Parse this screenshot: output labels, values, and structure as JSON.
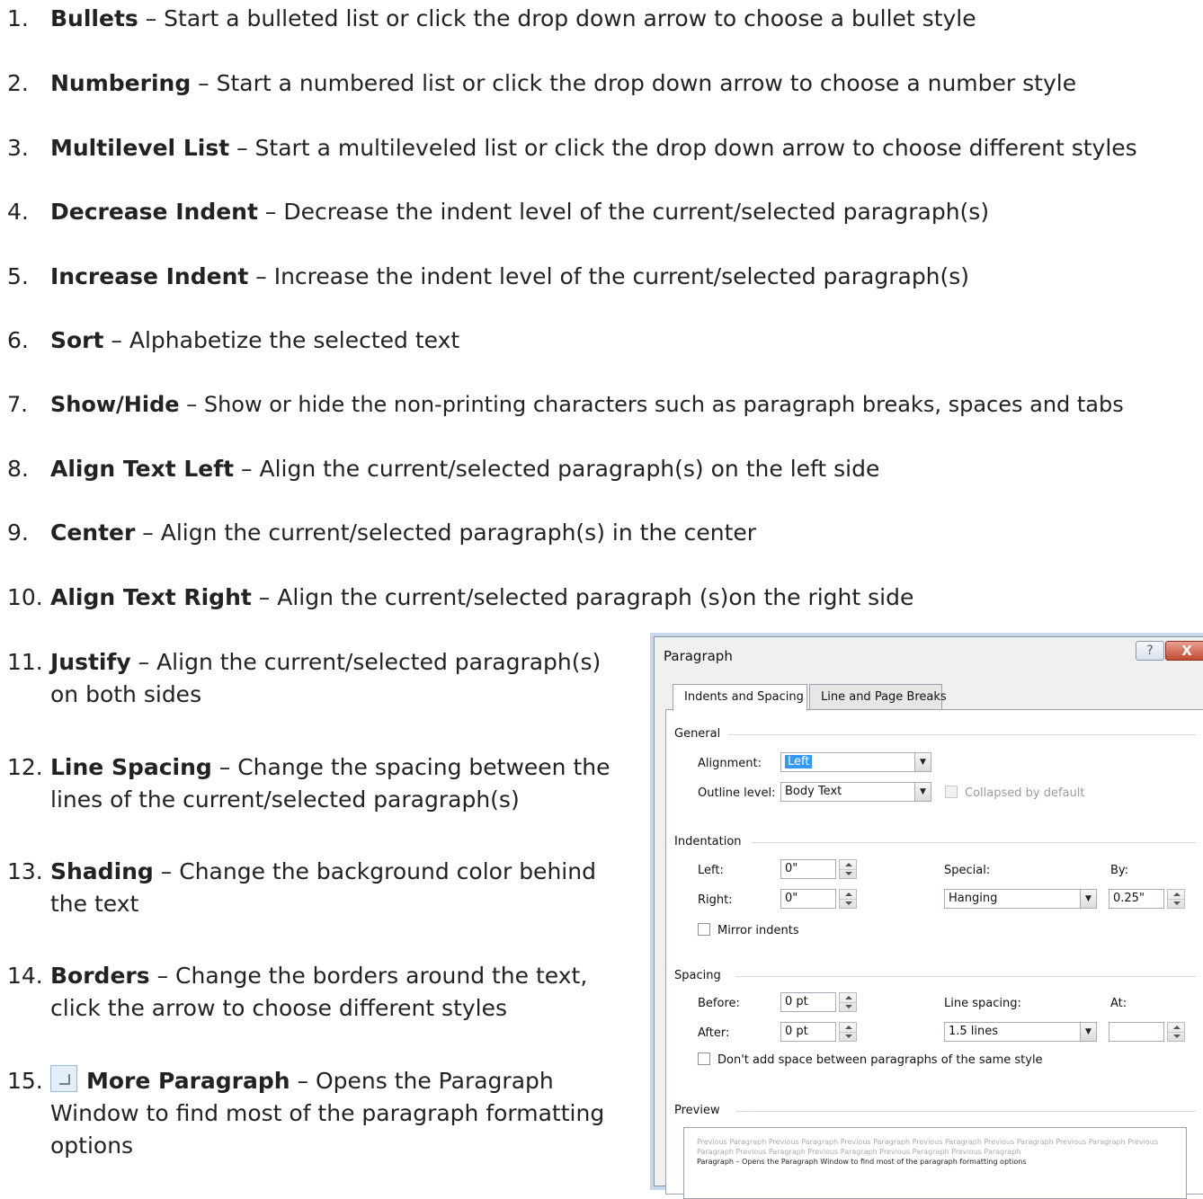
{
  "items": [
    {
      "num": "1.",
      "title": "Bullets",
      "desc": " – Start a bulleted list or click the drop down arrow to choose a bullet style"
    },
    {
      "num": "2.",
      "title": "Numbering",
      "desc": " – Start a numbered list or click the drop down arrow to choose a number style"
    },
    {
      "num": "3.",
      "title": "Multilevel List",
      "desc": " – Start a multileveled list or click the drop down arrow to choose different styles"
    },
    {
      "num": "4.",
      "title": "Decrease Indent",
      "desc": " – Decrease the indent level of the current/selected paragraph(s)"
    },
    {
      "num": "5.",
      "title": "Increase Indent",
      "desc": " – Increase the indent level of the current/selected paragraph(s)"
    },
    {
      "num": "6.",
      "title": "Sort",
      "desc": " – Alphabetize the selected text"
    },
    {
      "num": "7.",
      "title": "Show/Hide",
      "desc": " – Show or hide the non-printing characters such as paragraph breaks, spaces and tabs"
    },
    {
      "num": "8.",
      "title": "Align Text Left",
      "desc": " – Align the current/selected paragraph(s) on the left side"
    },
    {
      "num": "9.",
      "title": "Center",
      "desc": " – Align the current/selected paragraph(s) in the center"
    },
    {
      "num": "10.",
      "title": "Align Text Right",
      "desc": " – Align the current/selected paragraph (s)on the right side"
    },
    {
      "num": "11.",
      "title": "Justify",
      "desc": " – Align the current/selected paragraph(s)",
      "desc2": "on both sides"
    },
    {
      "num": "12.",
      "title": "Line Spacing",
      "desc": " – Change the spacing between the",
      "desc2": "lines of the current/selected paragraph(s)"
    },
    {
      "num": "13.",
      "title": "Shading",
      "desc": " – Change the background color behind",
      "desc2": "the text"
    },
    {
      "num": "14.",
      "title": "Borders",
      "desc": " – Change the borders around the text,",
      "desc2": "click the arrow to choose different styles"
    },
    {
      "num": "15.",
      "title": "More Paragraph",
      "desc": " – Opens the Paragraph",
      "desc2": "Window to find most of the paragraph formatting",
      "desc3": "options"
    }
  ],
  "dialog": {
    "title": "Paragraph",
    "help": "?",
    "close": "X",
    "tabs": [
      "Indents and Spacing",
      "Line and Page Breaks"
    ],
    "general": {
      "title": "General",
      "alignment_label": "Alignment:",
      "alignment_value": "Left",
      "outline_label": "Outline level:",
      "outline_value": "Body Text",
      "collapsed_label": "Collapsed by default"
    },
    "indentation": {
      "title": "Indentation",
      "left_label": "Left:",
      "left_value": "0\"",
      "right_label": "Right:",
      "right_value": "0\"",
      "special_label": "Special:",
      "special_value": "Hanging",
      "by_label": "By:",
      "by_value": "0.25\"",
      "mirror_label": "Mirror indents"
    },
    "spacing": {
      "title": "Spacing",
      "before_label": "Before:",
      "before_value": "0 pt",
      "after_label": "After:",
      "after_value": "0 pt",
      "line_spacing_label": "Line spacing:",
      "line_spacing_value": "1.5 lines",
      "at_label": "At:",
      "at_value": "",
      "dont_add_label": "Don't add space between paragraphs of the same style"
    },
    "preview": {
      "title": "Preview",
      "prev_text": "Previous Paragraph Previous Paragraph Previous Paragraph Previous Paragraph Previous Paragraph Previous Paragraph Previous Paragraph Previous Paragraph Previous Paragraph Previous Paragraph Previous Paragraph",
      "cur_text": "Paragraph – Opens the Paragraph Window to find most of the paragraph formatting options"
    }
  }
}
